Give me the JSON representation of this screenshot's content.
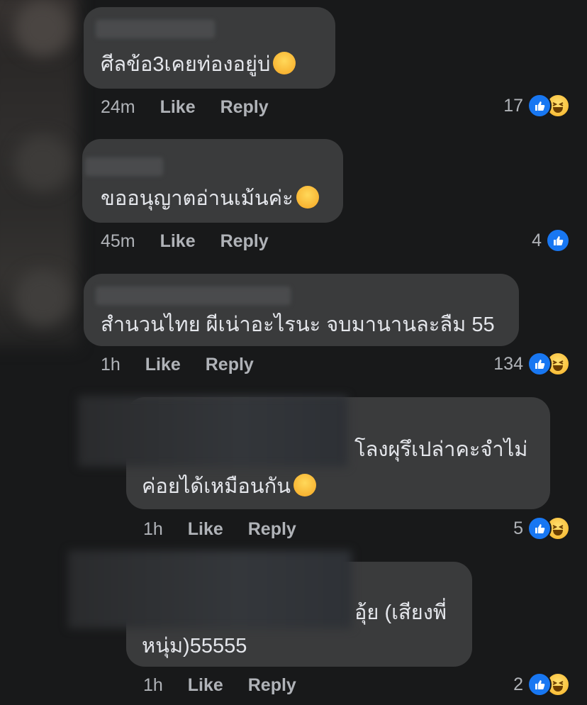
{
  "comments": [
    {
      "text": "ศีลข้อ3เคยท่องอยู่บ่",
      "emoji": "rolling-laughing-emoji",
      "time": "24m",
      "like_label": "Like",
      "reply_label": "Reply",
      "reaction_count": "17",
      "reactions": [
        "like-reaction-icon",
        "haha-reaction-icon"
      ]
    },
    {
      "text": "ขออนุญาตอ่านเม้นค่ะ",
      "emoji": "grinning-emoji",
      "time": "45m",
      "like_label": "Like",
      "reply_label": "Reply",
      "reaction_count": "4",
      "reactions": [
        "like-reaction-icon"
      ]
    },
    {
      "text": "สำนวนไทย ผีเน่าอะไรนะ จบมานานละลืม 55",
      "time": "1h",
      "like_label": "Like",
      "reply_label": "Reply",
      "reaction_count": "134",
      "reactions": [
        "like-reaction-icon",
        "haha-reaction-icon"
      ]
    },
    {
      "text_line1": "โลงผุรึเปล่าคะจำไม่",
      "text_line2": "ค่อยได้เหมือนกัน",
      "emoji": "slight-smile-emoji",
      "time": "1h",
      "like_label": "Like",
      "reply_label": "Reply",
      "reaction_count": "5",
      "reactions": [
        "like-reaction-icon",
        "haha-reaction-icon"
      ]
    },
    {
      "text_line1": "อุ้ย (เสียงพี่",
      "text_line2": "หนุ่ม)55555",
      "time": "1h",
      "like_label": "Like",
      "reply_label": "Reply",
      "reaction_count": "2",
      "reactions": [
        "like-reaction-icon",
        "haha-reaction-icon"
      ]
    }
  ],
  "colors": {
    "background": "#18191a",
    "bubble": "#3a3b3c",
    "text": "#e4e6eb",
    "meta": "#b0b3b8",
    "like_blue": "#1877f2",
    "haha_yellow": "#f7b125"
  }
}
